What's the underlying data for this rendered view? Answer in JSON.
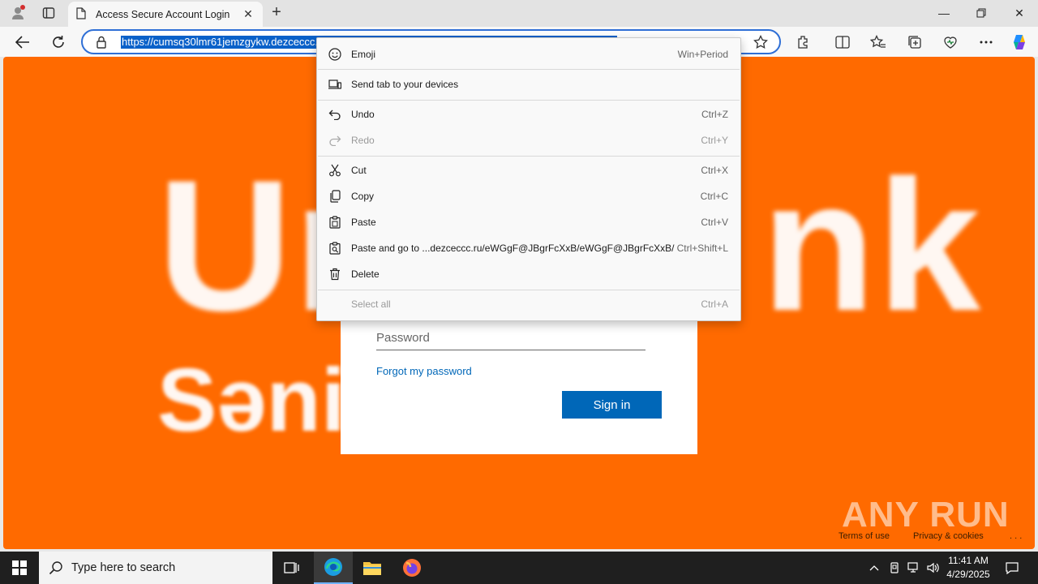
{
  "browser": {
    "tab_title": "Access Secure Account Login",
    "url": "https://cumsq30lmr61jemzgykw.dezceccc.ru/eWGgF@JBgrFcXxB/eWGgF@JBgrFcXxB/"
  },
  "page": {
    "brand_left": "Un",
    "brand_right": "nk",
    "brand_sub": "Sənin",
    "password_placeholder": "Password",
    "forgot_link": "Forgot my password",
    "signin_label": "Sign in",
    "footer_terms": "Terms of use",
    "footer_privacy": "Privacy & cookies",
    "footer_more": ". . .",
    "watermark": "ANY RUN",
    "background_color": "#ff6a00"
  },
  "context_menu": {
    "emoji": {
      "label": "Emoji",
      "key": "Win+Period"
    },
    "send_tab": {
      "label": "Send tab to your devices",
      "key": ""
    },
    "undo": {
      "label": "Undo",
      "key": "Ctrl+Z"
    },
    "redo": {
      "label": "Redo",
      "key": "Ctrl+Y"
    },
    "cut": {
      "label": "Cut",
      "key": "Ctrl+X"
    },
    "copy": {
      "label": "Copy",
      "key": "Ctrl+C"
    },
    "paste": {
      "label": "Paste",
      "key": "Ctrl+V"
    },
    "paste_go": {
      "label": "Paste and go to ...dezceccc.ru/eWGgF@JBgrFcXxB/eWGgF@JBgrFcXxB/",
      "key": "Ctrl+Shift+L"
    },
    "delete": {
      "label": "Delete",
      "key": ""
    },
    "select_all": {
      "label": "Select all",
      "key": "Ctrl+A"
    }
  },
  "taskbar": {
    "search_placeholder": "Type here to search",
    "time": "11:41 AM",
    "date": "4/29/2025"
  }
}
